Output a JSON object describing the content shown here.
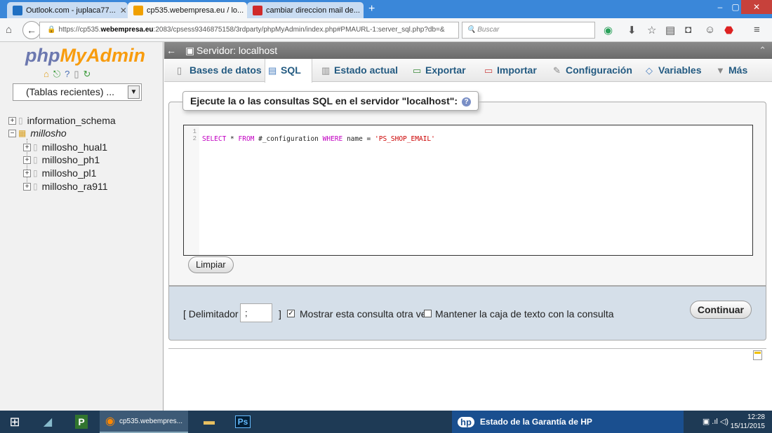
{
  "browser": {
    "tabs": [
      {
        "title": "Outlook.com - juplaca77...",
        "active": false,
        "favicon_color": "#1f6fc2"
      },
      {
        "title": "cp535.webempresa.eu / lo...",
        "active": true,
        "favicon_color": "#f0a000"
      },
      {
        "title": "cambiar direccion mail de...",
        "active": false,
        "favicon_color": "#d02a2a"
      }
    ],
    "new_tab": "+",
    "url_prefix": "https://cp535.",
    "url_host": "webempresa.eu",
    "url_rest": ":2083/cpsess9346875158/3rdparty/phpMyAdmin/index.php#PMAURL-1:server_sql.php?db=&",
    "search_placeholder": "Buscar"
  },
  "sidebar": {
    "logo_php": "php",
    "logo_myadmin": "MyAdmin",
    "recent_label": "(Tablas recientes) ...",
    "databases": [
      {
        "name": "information_schema",
        "expand": "+"
      },
      {
        "name": "millosho",
        "expand": "−"
      }
    ],
    "tables": [
      "millosho_hual1",
      "millosho_ph1",
      "millosho_pl1",
      "millosho_ra911"
    ]
  },
  "main": {
    "server_label": "Servidor: localhost",
    "tabs": [
      {
        "label": "Bases de datos",
        "active": false
      },
      {
        "label": "SQL",
        "active": true
      },
      {
        "label": "Estado actual",
        "active": false
      },
      {
        "label": "Exportar",
        "active": false
      },
      {
        "label": "Importar",
        "active": false
      },
      {
        "label": "Configuración",
        "active": false
      },
      {
        "label": "Variables",
        "active": false
      },
      {
        "label": "Más",
        "active": false
      }
    ],
    "legend": "Ejecute la o las consultas SQL en el servidor \"localhost\":",
    "line_numbers": [
      "1",
      "2"
    ],
    "query": {
      "kw1": "SELECT",
      "t1": " * ",
      "kw2": "FROM",
      "t2": " #_configuration ",
      "kw3": "WHERE",
      "t3": " name = ",
      "str": "'PS_SHOP_EMAIL'"
    },
    "clear_button": "Limpiar",
    "delimiter_label": "[ Delimitador",
    "delimiter_value": ";",
    "delimiter_close": "]",
    "show_query_label": "Mostrar esta consulta otra vez",
    "show_query_checked": true,
    "keep_box_label": "Mantener la caja de texto con la consulta",
    "keep_box_checked": false,
    "go_button": "Continuar"
  },
  "taskbar": {
    "firefox_label": "cp535.webempres...",
    "hp_label": "Estado de la Garantía de HP",
    "time": "12:28",
    "date": "15/11/2015"
  }
}
